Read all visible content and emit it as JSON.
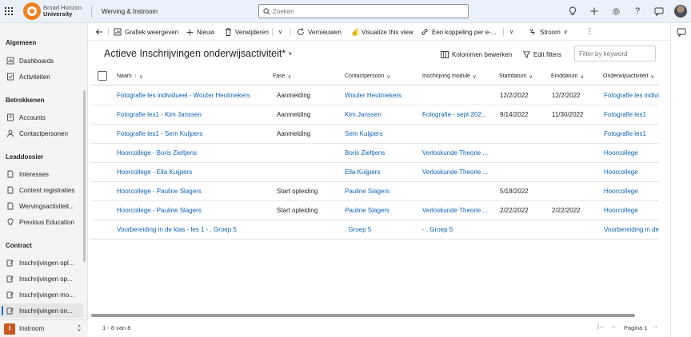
{
  "header": {
    "brand_line1": "Broad Horizon",
    "brand_line2": "University",
    "app_name": "Werving & Instroom",
    "search_placeholder": "Zoeken",
    "icons": [
      "waffle-icon",
      "lightbulb-icon",
      "plus-icon",
      "settings-icon",
      "help-icon",
      "chat-icon"
    ],
    "accent_color": "#f08020"
  },
  "nav": {
    "groups": {
      "algemeen": "Algemeen",
      "betrokkenen": "Betrokkenen",
      "leaddossier": "Leaddossier",
      "contract": "Contract"
    },
    "items": {
      "dashboards": "Dashboards",
      "activiteiten": "Activiteiten",
      "accounts": "Accounts",
      "contactpersonen": "Contactpersonen",
      "interesses": "Interesses",
      "content_registraties": "Content registraties",
      "wervingsactiviteit": "Wervingsactiviteit...",
      "previous_education": "Previous Education",
      "inschrijvingen_1": "Inschrijvingen opl...",
      "inschrijvingen_2": "Inschrijvingen op...",
      "inschrijvingen_3": "Inschrijvingen mo...",
      "inschrijvingen_4": "Inschrijvingen on..."
    },
    "area": {
      "badge": "I",
      "label": "Instroom",
      "badge_color": "#c8581e"
    }
  },
  "toolbar": {
    "grafiek": "Grafiek weergeven",
    "nieuw": "Nieuw",
    "verwijderen": "Verwijderen",
    "vernieuwen": "Vernieuwen",
    "visualize": "Visualize this view",
    "koppeling": "Een koppeling per e-...",
    "stroom": "Stroom"
  },
  "view": {
    "title": "Actieve Inschrijvingen onderwijsactiviteit*",
    "kolommen": "Kolommen bewerken",
    "filters": "Edit filters",
    "filter_placeholder": "Filter by keyword"
  },
  "grid": {
    "columns": {
      "naam": "Naam",
      "fase": "Fase",
      "contact": "Contactpersoon",
      "module": "Inschrijving module",
      "start": "Startdatum",
      "eind": "Einddatum",
      "activiteit": "Onderwijsactiviteit"
    },
    "rows": [
      {
        "naam": "Fotografie les individueel - Wouter Heutmekers",
        "fase": "Aanmelding",
        "contact": "Wouter Heutmekers",
        "module": "",
        "start": "12/2/2022",
        "eind": "12/2/2022",
        "activiteit": "Fotografie les individ"
      },
      {
        "naam": "Fotografie les1 - Kim Janssen",
        "fase": "Aanmelding",
        "contact": "Kim Janssen",
        "module": "Fotografie - sept 202...",
        "start": "9/14/2022",
        "eind": "11/30/2022",
        "activiteit": "Fotografie les1"
      },
      {
        "naam": "Fotografie les1 - Sem Kuijpers",
        "fase": "Aanmelding",
        "contact": "Sem Kuijpers",
        "module": "",
        "start": "",
        "eind": "",
        "activiteit": "Fotografie les1"
      },
      {
        "naam": "Hoorcollege - Boris Zieltjens",
        "fase": "",
        "contact": "Boris Zieltjens",
        "module": "Verloskunde Theorie ...",
        "start": "",
        "eind": "",
        "activiteit": "Hoorcollege"
      },
      {
        "naam": "Hoorcollege - Ella Kuijpers",
        "fase": "",
        "contact": "Ella Kuijpers",
        "module": "Verloskunde Theorie ...",
        "start": "",
        "eind": "",
        "activiteit": "Hoorcollege"
      },
      {
        "naam": "Hoorcollege - Pauline Slagers",
        "fase": "Start opleiding",
        "contact": "Pauline Slagers",
        "module": "",
        "start": "5/18/2022",
        "eind": "",
        "activiteit": "Hoorcollege"
      },
      {
        "naam": "Hoorcollege - Pauline Slagers",
        "fase": "Start opleiding",
        "contact": "Pauline Slagers",
        "module": "Verloskunde Theorie ...",
        "start": "2/22/2022",
        "eind": "2/22/2022",
        "activiteit": "Hoorcollege"
      },
      {
        "naam": "Voorbereiding in de klas - les 1 - . Groep 5",
        "fase": "",
        "contact": ". Groep 5",
        "module": "- . Groep 5",
        "start": "",
        "eind": "",
        "activiteit": "Voorbereiding in de"
      }
    ],
    "link_color": "#1063b7"
  },
  "footer": {
    "count": "1 - 8 van 8",
    "page": "Pagina 1"
  }
}
